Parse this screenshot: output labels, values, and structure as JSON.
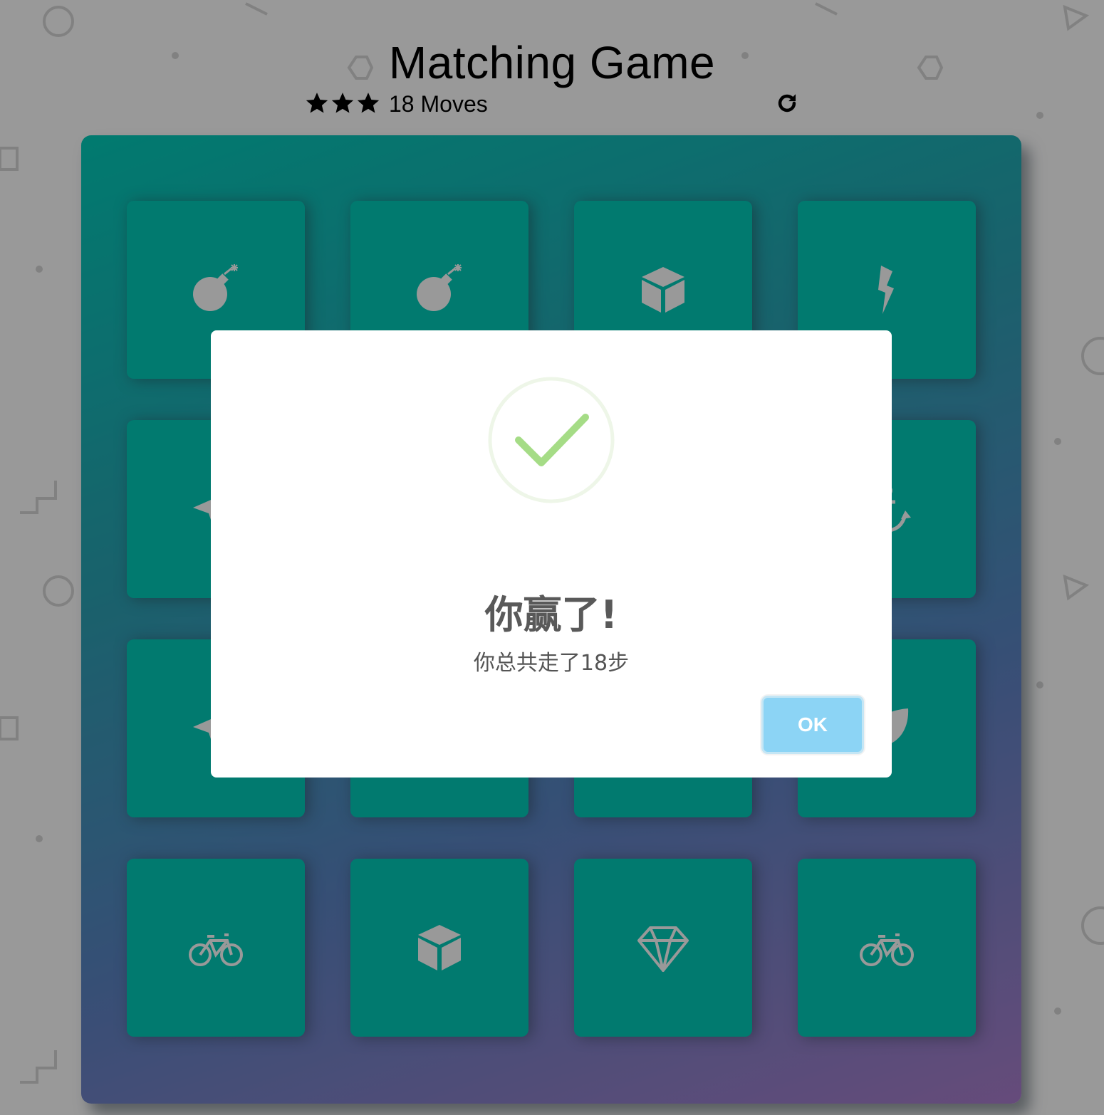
{
  "page_title": "Matching Game",
  "score_panel": {
    "stars_count": 3,
    "moves_text": "18 Moves",
    "restart_icon": "restart-icon"
  },
  "deck": {
    "rows": [
      [
        {
          "icon": "bomb"
        },
        {
          "icon": "bomb"
        },
        {
          "icon": "cube"
        },
        {
          "icon": "bolt"
        }
      ],
      [
        {
          "icon": "paper-plane"
        },
        {
          "icon": "hidden"
        },
        {
          "icon": "hidden"
        },
        {
          "icon": "anchor"
        }
      ],
      [
        {
          "icon": "paper-plane"
        },
        {
          "icon": "hidden"
        },
        {
          "icon": "hidden"
        },
        {
          "icon": "leaf"
        }
      ],
      [
        {
          "icon": "bicycle"
        },
        {
          "icon": "cube"
        },
        {
          "icon": "diamond"
        },
        {
          "icon": "bicycle"
        }
      ]
    ],
    "card_color": "#02ccba",
    "icon_color": "#ffffff"
  },
  "modal": {
    "title": "你赢了!",
    "text": "你总共走了18步",
    "ok_label": "OK",
    "success_icon": "check-circle-icon"
  },
  "colors": {
    "accent_success": "#a5dc86",
    "button": "#8cd4f5"
  }
}
